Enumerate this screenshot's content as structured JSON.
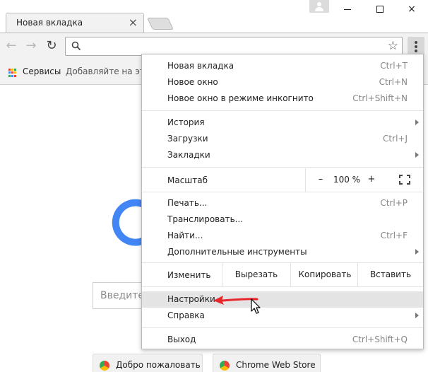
{
  "tab": {
    "title": "Новая вкладка",
    "close": "×"
  },
  "window": {
    "minimize": "minimize",
    "maximize": "maximize",
    "close": "×"
  },
  "toolbar": {
    "back": "←",
    "forward": "→",
    "reload": "↻",
    "star": "☆"
  },
  "bookmarks": {
    "services": "Сервисы",
    "hint": "Добавляйте на эту"
  },
  "page": {
    "search_placeholder": "Введите",
    "tiles": [
      {
        "label": "Добро пожаловать в"
      },
      {
        "label": "Chrome Web Store"
      }
    ]
  },
  "menu": {
    "group1": [
      {
        "label": "Новая вкладка",
        "shortcut": "Ctrl+T"
      },
      {
        "label": "Новое окно",
        "shortcut": "Ctrl+N"
      },
      {
        "label": "Новое окно в режиме инкогнито",
        "shortcut": "Ctrl+Shift+N"
      }
    ],
    "group2": [
      {
        "label": "История",
        "shortcut": ""
      },
      {
        "label": "Загрузки",
        "shortcut": "Ctrl+J"
      },
      {
        "label": "Закладки",
        "shortcut": ""
      }
    ],
    "zoom": {
      "label": "Масштаб",
      "minus": "–",
      "value": "100 %",
      "plus": "+"
    },
    "group3": [
      {
        "label": "Печать...",
        "shortcut": "Ctrl+P"
      },
      {
        "label": "Транслировать...",
        "shortcut": ""
      },
      {
        "label": "Найти...",
        "shortcut": "Ctrl+F"
      },
      {
        "label": "Дополнительные инструменты",
        "shortcut": ""
      }
    ],
    "edit": {
      "label": "Изменить",
      "cut": "Вырезать",
      "copy": "Копировать",
      "paste": "Вставить"
    },
    "group4": [
      {
        "label": "Настройки",
        "shortcut": ""
      },
      {
        "label": "Справка",
        "shortcut": ""
      }
    ],
    "exit": {
      "label": "Выход",
      "shortcut": "Ctrl+Shift+Q"
    }
  },
  "colors": {
    "accent_red": "#e8262b",
    "google_blue": "#4285f4",
    "hover_bg": "#e4e4e4"
  }
}
